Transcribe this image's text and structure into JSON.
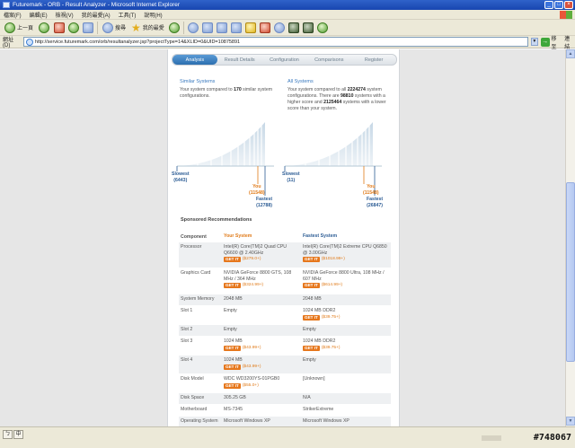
{
  "window": {
    "title": "Futuremark - ORB - Result Analyzer - Microsoft Internet Explorer",
    "buttons": [
      "_",
      "□",
      "×"
    ]
  },
  "menu": [
    "檔案(F)",
    "編輯(E)",
    "檢視(V)",
    "我的最愛(A)",
    "工具(T)",
    "說明(H)"
  ],
  "toolbar": {
    "back": "上一頁",
    "search": "搜尋",
    "favorites": "我的最愛"
  },
  "address": {
    "label": "網址(D)",
    "url": "http://service.futuremark.com/orb/resultanalyzer.jsp?projectType=14&XLID=0&UID=10875891",
    "go": "移至",
    "links": "連結"
  },
  "tabs": [
    "Analysis",
    "Result Details",
    "Configuration",
    "Comparisons",
    "Register"
  ],
  "similar": {
    "title": "Similar Systems",
    "text_pre": "Your system compared to ",
    "count": "170",
    "text_post": " similar system configurations.",
    "slowest_label": "Slowest",
    "slowest_value": "(6443)",
    "you_label": "You",
    "you_value": "(11548)",
    "fastest_label": "Fastest",
    "fastest_value": "(12788)"
  },
  "all": {
    "title": "All Systems",
    "text_pre": "Your system compared to all ",
    "total": "2224274",
    "text_mid1": " system configurations. There are ",
    "higher": "98810",
    "text_mid2": " systems with a higher score and ",
    "lower": "2125464",
    "text_post": " systems with a lower score than your system.",
    "slowest_label": "Slowest",
    "slowest_value": "(11)",
    "you_label": "You",
    "you_value": "(11548)",
    "fastest_label": "Fastest",
    "fastest_value": "(26847)"
  },
  "sponsored": "Sponsored Recommendations",
  "table": {
    "headers": [
      "Component",
      "Your System",
      "Fastest System"
    ],
    "getit": "GET IT",
    "rows": [
      {
        "component": "Processor",
        "yours": "Intel(R) Core(TM)2 Quad CPU Q6600 @ 2.40GHz",
        "yours_price": "($279.0+)",
        "fastest": "Intel(R) Core(TM)2 Extreme CPU Q6850 @ 3.00GHz",
        "fastest_price": "($1018.99+)"
      },
      {
        "component": "Graphics Card",
        "yours": "NVIDIA GeForce 8800 GTS, 108 MHz / 364 MHz",
        "yours_price": "($324.99+)",
        "fastest": "NVIDIA GeForce 8800 Ultra, 108 MHz / 607 MHz",
        "fastest_price": "($614.99+)"
      },
      {
        "component": "System Memory",
        "yours": "2048 MB",
        "yours_price": "",
        "fastest": "2048 MB",
        "fastest_price": ""
      },
      {
        "component": "Slot 1",
        "yours": "Empty",
        "yours_price": "",
        "fastest": "1024 MB DDR2",
        "fastest_price": "($39.75+)"
      },
      {
        "component": "Slot 2",
        "yours": "Empty",
        "yours_price": "",
        "fastest": "Empty",
        "fastest_price": ""
      },
      {
        "component": "Slot 3",
        "yours": "1024 MB",
        "yours_price": "($43.99+)",
        "fastest": "1024 MB DDR2",
        "fastest_price": "($39.75+)"
      },
      {
        "component": "Slot 4",
        "yours": "1024 MB",
        "yours_price": "($43.99+)",
        "fastest": "Empty",
        "fastest_price": ""
      },
      {
        "component": "Disk Model",
        "yours": "WDC WD3200YS-01PGB0",
        "yours_price": "($55.0+)",
        "fastest": "[Unknown]",
        "fastest_price": ""
      },
      {
        "component": "Disk Space",
        "yours": "305.25 GB",
        "yours_price": "",
        "fastest": "N/A",
        "fastest_price": ""
      },
      {
        "component": "Motherboard",
        "yours": "MS-7345",
        "yours_price": "",
        "fastest": "StrikerExtreme",
        "fastest_price": ""
      },
      {
        "component": "Operating System",
        "yours": "Microsoft Windows XP",
        "yours_price": "",
        "fastest": "Microsoft Windows XP",
        "fastest_price": ""
      }
    ]
  },
  "status": {
    "ime1": "ㄅ",
    "ime2": "中",
    "watermark": "#748067"
  },
  "colors": {
    "accent_blue": "#3a7abf",
    "orange": "#e07a18",
    "getit": "#e6771c"
  }
}
